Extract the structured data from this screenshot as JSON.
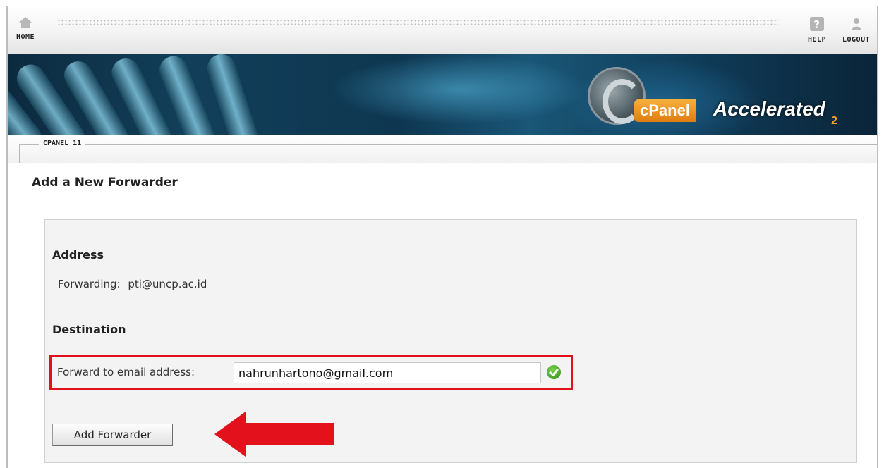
{
  "nav": {
    "home_label": "HOME",
    "help_label": "HELP",
    "logout_label": "LOGOUT",
    "icons": [
      "home-icon",
      "help-icon",
      "logout-icon"
    ]
  },
  "banner": {
    "brand_panel": "cPanel",
    "brand_accelerated": "Accelerated",
    "brand_version": "2"
  },
  "strip": {
    "version_label": "CPANEL 11"
  },
  "page": {
    "title": "Add a New Forwarder"
  },
  "form": {
    "address_heading": "Address",
    "forwarding_label": "Forwarding:",
    "forwarding_value": "pti@uncp.ac.id",
    "destination_heading": "Destination",
    "forward_label": "Forward to email address:",
    "forward_value": "nahrunhartono@gmail.com",
    "submit_label": "Add Forwarder"
  },
  "colors": {
    "highlight": "#e3111b",
    "arrow": "#e3111b",
    "valid_check": "#2e8f16"
  }
}
